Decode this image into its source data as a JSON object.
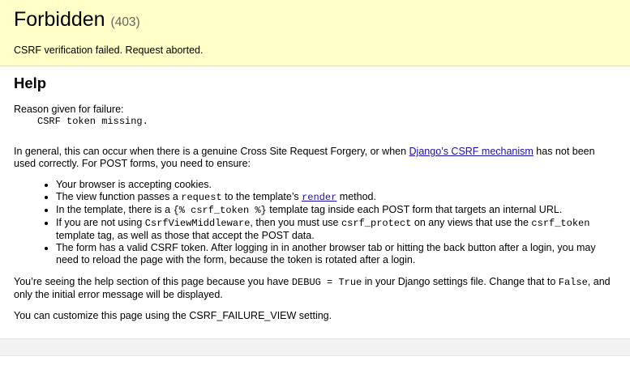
{
  "summary": {
    "title": "Forbidden",
    "code": "(403)",
    "message": "CSRF verification failed. Request aborted."
  },
  "help": {
    "heading": "Help",
    "reason_label": "Reason given for failure:",
    "reason_value": "CSRF token missing.",
    "intro_before": "In general, this can occur when there is a genuine Cross Site Request Forgery, or when ",
    "intro_link": "Django’s CSRF mechanism",
    "intro_after": " has not been used correctly. For POST forms, you need to ensure:",
    "bullets": {
      "b1": "Your browser is accepting cookies.",
      "b2_pre": "The view function passes a ",
      "b2_code": "request",
      "b2_mid": " to the template’s ",
      "b2_link": "render",
      "b2_post": " method.",
      "b3_pre": "In the template, there is a ",
      "b3_code": "{% csrf_token %}",
      "b3_post": " template tag inside each POST form that targets an internal URL.",
      "b4_pre": "If you are not using ",
      "b4_code1": "CsrfViewMiddleware",
      "b4_mid": ", then you must use ",
      "b4_code2": "csrf_protect",
      "b4_mid2": " on any views that use the ",
      "b4_code3": "csrf_token",
      "b4_post": " template tag, as well as those that accept the POST data.",
      "b5": "The form has a valid CSRF token. After logging in in another browser tab or hitting the back button after a login, you may need to reload the page with the form, because the token is rotated after a login."
    },
    "debug_pre": "You’re seeing the help section of this page because you have ",
    "debug_code": "DEBUG = True",
    "debug_mid": " in your Django settings file. Change that to ",
    "debug_code2": "False",
    "debug_post": ", and only the initial error message will be displayed.",
    "customize": "You can customize this page using the CSRF_FAILURE_VIEW setting."
  }
}
